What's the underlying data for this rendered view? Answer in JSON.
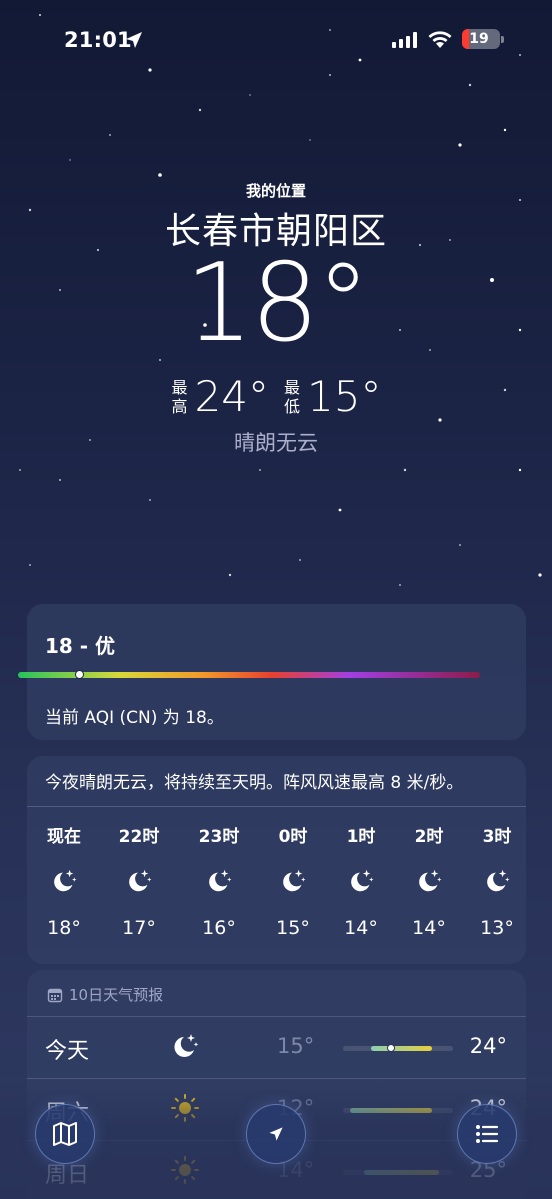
{
  "status_bar": {
    "time": "21:01",
    "battery": "19",
    "battery_level": 0.19
  },
  "location": {
    "label": "我的位置",
    "city": "长春市朝阳区"
  },
  "current": {
    "temp": "18°",
    "high_label": "最高",
    "high": "24°",
    "low_label": "最低",
    "low": "15°",
    "condition": "晴朗无云"
  },
  "aqi": {
    "title": "18 - 优",
    "value": 18,
    "description": "当前 AQI (CN) 为 18。",
    "colors": [
      "#27c45d",
      "#d8d83a",
      "#f29a2a",
      "#e8402e",
      "#a23ee3",
      "#8b1c4a"
    ]
  },
  "hourly": {
    "summary": "今夜晴朗无云，将持续至天明。阵风风速最高 8 米/秒。",
    "items": [
      {
        "label": "现在",
        "icon": "moon-stars-icon",
        "temp": "18°"
      },
      {
        "label": "22时",
        "icon": "moon-stars-icon",
        "temp": "17°"
      },
      {
        "label": "23时",
        "icon": "moon-stars-icon",
        "temp": "16°"
      },
      {
        "label": "0时",
        "icon": "moon-stars-icon",
        "temp": "15°"
      },
      {
        "label": "1时",
        "icon": "moon-stars-icon",
        "temp": "14°"
      },
      {
        "label": "2时",
        "icon": "moon-stars-icon",
        "temp": "14°"
      },
      {
        "label": "3时",
        "icon": "moon-stars-icon",
        "temp": "13°"
      }
    ]
  },
  "daily": {
    "header": "10日天气预报",
    "header_icon": "calendar-icon",
    "days": [
      {
        "name": "今天",
        "icon": "moon-stars-icon",
        "low": "15°",
        "high": "24°"
      },
      {
        "name": "周六",
        "icon": "sun-icon",
        "low": "12°",
        "high": "24°"
      },
      {
        "name": "周日",
        "icon": "sun-icon",
        "low": "14°",
        "high": "25°"
      }
    ]
  },
  "bottom_bar": {
    "left_icon": "map-icon",
    "center_icon": "location-arrow-icon",
    "right_icon": "list-icon"
  }
}
